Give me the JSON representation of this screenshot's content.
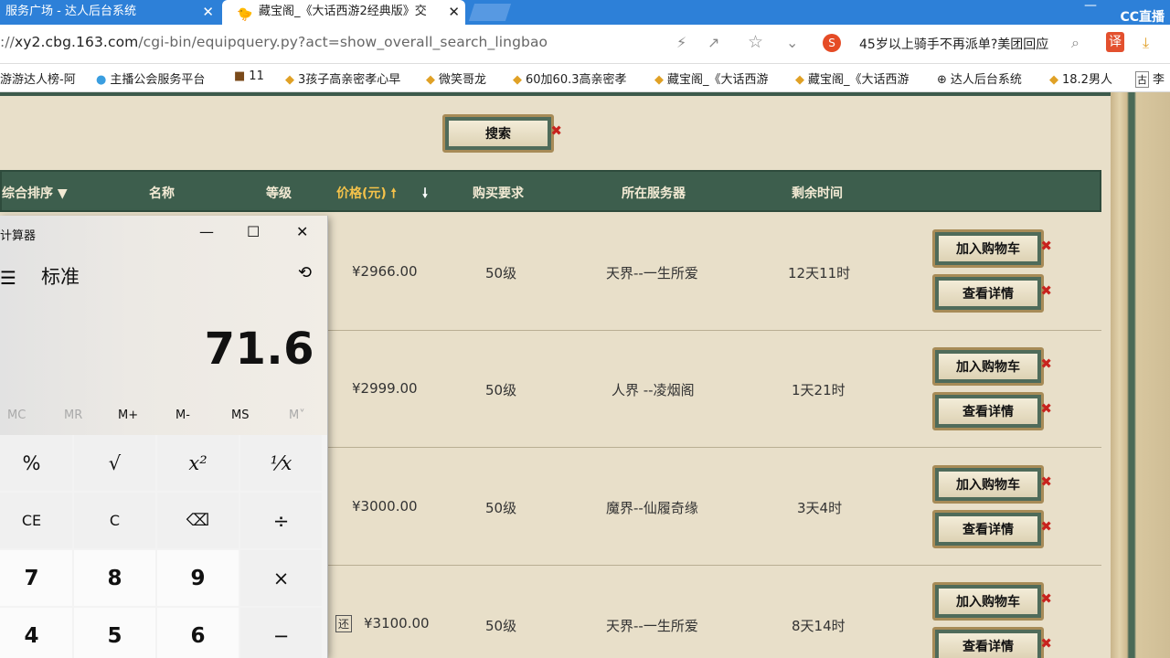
{
  "browser": {
    "tabs": [
      {
        "title": "服务广场 - 达人后台系统"
      },
      {
        "title": "藏宝阁_《大话西游2经典版》交"
      }
    ],
    "cc_logo": "CC直播",
    "url_prefix": "://",
    "url_main": "xy2.cbg.163.com",
    "url_path": "/cgi-bin/equipquery.py?act=show_overall_search_lingbao",
    "news_text": "45岁以上骑手不再派单?美团回应",
    "bookmarks": [
      {
        "label": "游游达人榜-阿"
      },
      {
        "label": "主播公会服务平台"
      },
      {
        "label": "11"
      },
      {
        "label": "3孩子高亲密孝心早"
      },
      {
        "label": "微笑哥龙"
      },
      {
        "label": "60加60.3高亲密孝"
      },
      {
        "label": "藏宝阁_《大话西游"
      },
      {
        "label": "藏宝阁_《大话西游"
      },
      {
        "label": "达人后台系统"
      },
      {
        "label": "18.2男人"
      },
      {
        "label": "李"
      }
    ]
  },
  "page": {
    "search_button": "搜索",
    "headers": {
      "sort": "综合排序",
      "name": "名称",
      "level": "等级",
      "price": "价格(元)",
      "req": "购买要求",
      "server": "所在服务器",
      "time": "剩余时间"
    },
    "rows": [
      {
        "price": "¥2966.00",
        "req": "50级",
        "server": "天界--一生所爱",
        "time": "12天11时",
        "badge": ""
      },
      {
        "price": "¥2999.00",
        "req": "50级",
        "server": "人界 --凌烟阁",
        "time": "1天21时",
        "badge": ""
      },
      {
        "price": "¥3000.00",
        "req": "50级",
        "server": "魔界--仙履奇缘",
        "time": "3天4时",
        "badge": ""
      },
      {
        "price": "¥3100.00",
        "req": "50级",
        "server": "天界--一生所爱",
        "time": "8天14时",
        "badge": "还"
      }
    ],
    "add_cart": "加入购物车",
    "view_detail": "查看详情"
  },
  "calculator": {
    "title": "计算器",
    "mode": "标准",
    "display": "71.6",
    "memory": [
      "MC",
      "MR",
      "M+",
      "M-",
      "MS",
      "M˅"
    ],
    "keys": [
      [
        "%",
        "√",
        "x²",
        "⅟x"
      ],
      [
        "CE",
        "C",
        "⌫",
        "÷"
      ],
      [
        "7",
        "8",
        "9",
        "×"
      ],
      [
        "4",
        "5",
        "6",
        "−"
      ]
    ]
  }
}
